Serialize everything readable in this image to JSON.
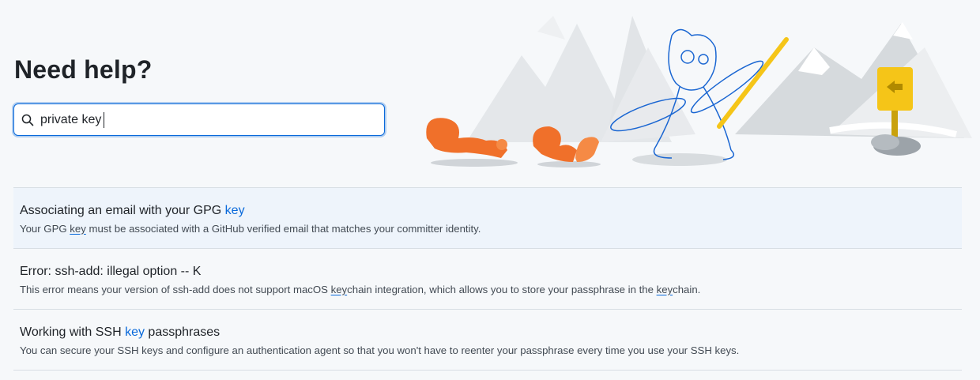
{
  "page": {
    "title": "Need help?"
  },
  "search": {
    "value": "private key",
    "icon": "search-icon"
  },
  "results": [
    {
      "title_pre": "Associating an email with your GPG ",
      "title_hl": "key",
      "title_post": "",
      "desc_pre": "Your GPG ",
      "desc_hl": "key",
      "desc_post": " must be associated with a GitHub verified email that matches your committer identity."
    },
    {
      "title": "Error: ssh-add: illegal option -- K",
      "desc_pre": "This error means your version of ssh-add does not support macOS ",
      "desc_hl": "key",
      "desc_mid": "chain integration, which allows you to store your passphrase in the ",
      "desc_hl2": "key",
      "desc_post": "chain."
    },
    {
      "title_pre": "Working with SSH ",
      "title_hl": "key",
      "title_post": " passphrases",
      "desc": "You can secure your SSH keys and configure an authentication agent so that you won't have to reenter your passphrase every time you use your SSH keys."
    }
  ],
  "colors": {
    "accent": "#0969da",
    "active_row": "#eef4fb",
    "squirrel": "#f0702a",
    "sign": "#f5c518"
  }
}
